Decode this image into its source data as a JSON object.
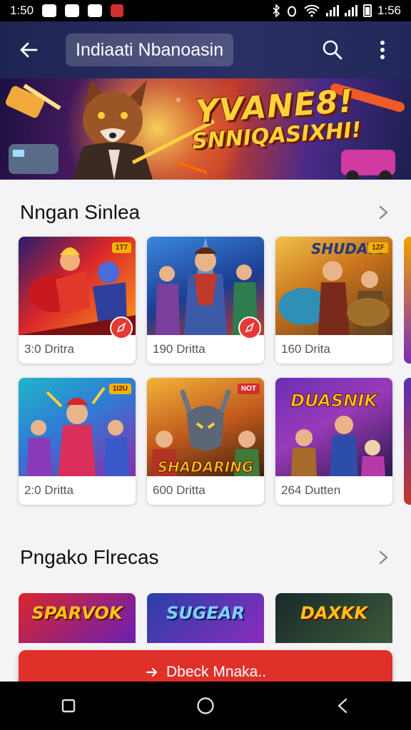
{
  "status_bar": {
    "time": "1:50",
    "right_time": "1:56"
  },
  "app_bar": {
    "title": "Indiaati Nbanoasin"
  },
  "hero": {
    "line1": "YVANE8!",
    "line2": "SNNIQASIXHI!"
  },
  "sections": [
    {
      "title": "Nngan Sinlea",
      "cards": [
        {
          "label": "3:0 Dritra",
          "badge": "1T7"
        },
        {
          "label": "190 Dritta",
          "badge": ""
        },
        {
          "label": "160 Drita",
          "badge": "1ZF"
        },
        {
          "label": "2:0 Dritta",
          "badge": "1I2U"
        },
        {
          "label": "600 Dritta",
          "badge": "NOT"
        },
        {
          "label": "264 Dutten",
          "badge": ""
        }
      ]
    },
    {
      "title": "Pngako Flrecas",
      "cards": [
        {
          "title": "SPARVOK"
        },
        {
          "title": "SUGEAR"
        },
        {
          "title": "DAXKK"
        }
      ]
    }
  ],
  "card_art_titles": {
    "shadow": "SHADARING",
    "dusk": "DUASNIK"
  },
  "cta": {
    "label": "Dbeck Mnaka.."
  },
  "colors": {
    "app_bar": "#23285a",
    "accent": "#e0302a"
  }
}
